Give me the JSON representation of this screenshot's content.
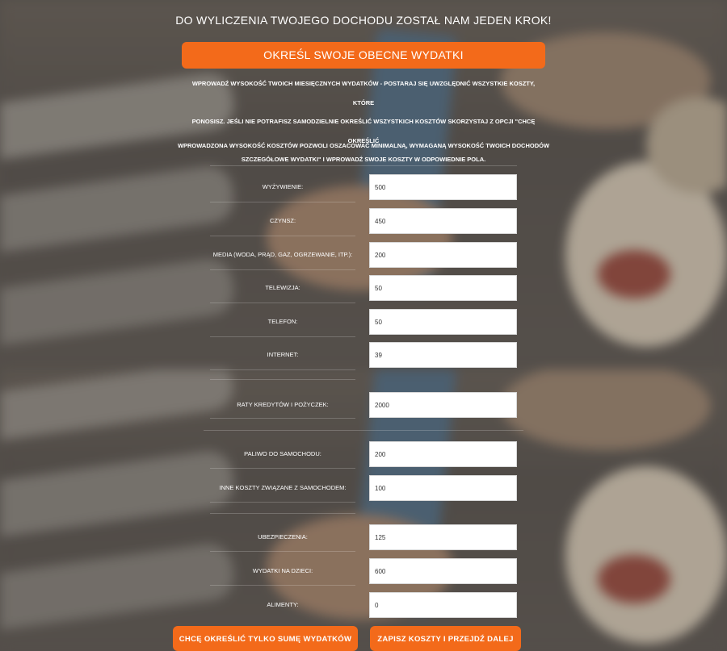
{
  "header": {
    "headline": "DO WYLICZENIA TWOJEGO DOCHODU ZOSTAŁ NAM JEDEN KROK!"
  },
  "section": {
    "title": "OKREŚL SWOJE OBECNE WYDATKI"
  },
  "intro": {
    "line1": "WPROWADŹ WYSOKOŚĆ TWOICH MIESIĘCZNYCH WYDATKÓW - POSTARAJ SIĘ UWZGLĘDNIĆ WSZYSTKIE KOSZTY, KTÓRE",
    "line2": "PONOSISZ. JEŚLI NIE POTRAFISZ SAMODZIELNIE OKREŚLIĆ WSZYSTKICH KOSZTÓW SKORZYSTAJ Z OPCJI \"CHCĘ OKREŚLIĆ",
    "line3": "SZCZEGÓŁOWE WYDATKI\" I WPROWADŹ SWOJE KOSZTY W ODPOWIEDNIE POLA."
  },
  "note": "WPROWADZONA WYSOKOŚĆ KOSZTÓW POZWOLI OSZACOWAĆ MINIMALNĄ, WYMAGANĄ WYSOKOŚĆ TWOICH DOCHODÓW",
  "expenses": [
    {
      "label": "WYŻYWIENIE:",
      "value": "500"
    },
    {
      "label": "CZYNSZ:",
      "value": "450"
    },
    {
      "label": "MEDIA (WODA, PRĄD, GAZ, OGRZEWANIE, ITP.):",
      "value": "200"
    },
    {
      "label": "TELEWIZJA:",
      "value": "50"
    },
    {
      "label": "TELEFON:",
      "value": "50"
    },
    {
      "label": "INTERNET:",
      "value": "39"
    },
    {
      "label": "RATY KREDYTÓW I POŻYCZEK:",
      "value": "2000"
    },
    {
      "label": "PALIWO DO SAMOCHODU:",
      "value": "200"
    },
    {
      "label": "INNE KOSZTY ZWIĄZANE Z SAMOCHODEM:",
      "value": "100"
    },
    {
      "label": "UBEZPIECZENIA:",
      "value": "125"
    },
    {
      "label": "WYDATKI NA DZIECI:",
      "value": "600"
    },
    {
      "label": "ALIMENTY:",
      "value": "0"
    }
  ],
  "buttons": {
    "sum_only": "CHCĘ OKREŚLIĆ TYLKO SUMĘ WYDATKÓW",
    "save_next": "ZAPISZ KOSZTY I PRZEJDŹ DALEJ"
  },
  "colors": {
    "accent": "#f36a1a",
    "text": "#ffffff",
    "input_bg": "#ffffff"
  }
}
